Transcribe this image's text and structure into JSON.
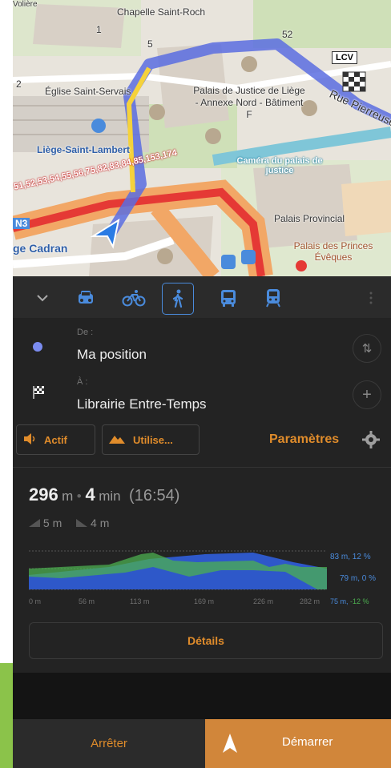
{
  "map": {
    "labels": {
      "chapelle": "Chapelle Saint-Roch",
      "eglise": "Église Saint-Servais",
      "palais_justice": "Palais de Justice de Liège - Annexe Nord - Bâtiment F",
      "liege_lambert": "Liège-Saint-Lambert",
      "camera": "Caméra du palais de justice",
      "rue_pierreuse": "Rue Pierreuse",
      "palais_provincial": "Palais Provincial",
      "palais_princes": "Palais des Princes Évêques",
      "cadran": "ge Cadran",
      "n3": "N3",
      "bus_lines": "51,52,53,54,55,56,75,82,83,84,85,153,174",
      "lcv": "LCV",
      "num1": "1",
      "num2": "2",
      "num5": "5",
      "num52": "52",
      "voliere": "Volière"
    }
  },
  "modes": [
    "car-icon",
    "bicycle-icon",
    "walk-icon",
    "bus-icon",
    "train-icon"
  ],
  "route": {
    "from_label": "De :",
    "from_value": "Ma position",
    "to_label": "À :",
    "to_value": "Librairie Entre-Temps"
  },
  "options": {
    "sound_label": "Actif",
    "avoid_label": "Utilise...",
    "settings_label": "Paramètres"
  },
  "summary": {
    "distance": "296",
    "distance_unit": "m",
    "time": "4",
    "time_unit": "min",
    "arrival": "(16:54)",
    "ascent": "5 m",
    "descent": "4 m"
  },
  "elevation": {
    "ticks": [
      "0 m",
      "56 m",
      "113 m",
      "169 m",
      "226 m",
      "282 m"
    ],
    "legend_top": "83 m, 12 %",
    "legend_mid": "79 m, 0 %",
    "legend_bottom_blue": "75 m,",
    "legend_bottom_green": "-12 %"
  },
  "details_label": "Détails",
  "bottom": {
    "stop_label": "Arrêter",
    "start_label": "Démarrer"
  },
  "colors": {
    "accent": "#e08c2b",
    "blue": "#4a8bdc",
    "panel": "#232323",
    "route": "#5a6de0"
  }
}
